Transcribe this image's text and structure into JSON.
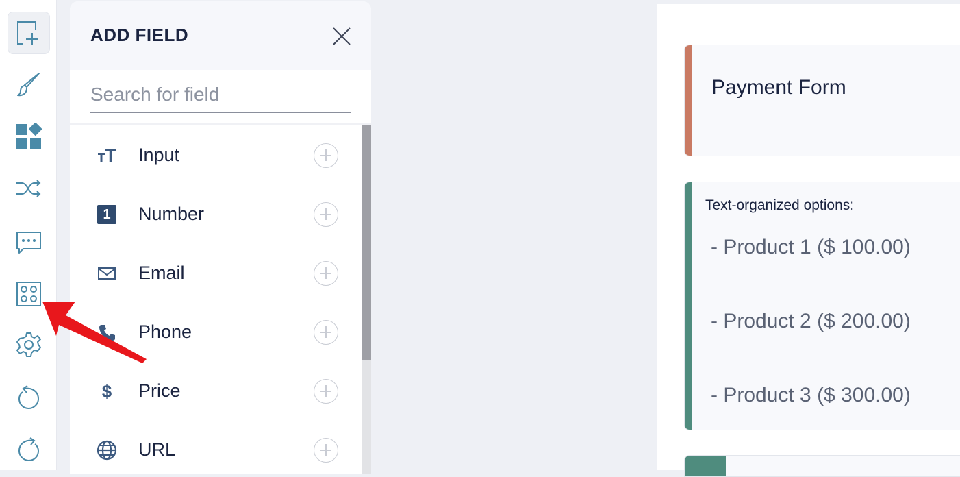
{
  "rail": {
    "items": [
      {
        "icon": "add-field-icon",
        "active": true
      },
      {
        "icon": "brush-icon"
      },
      {
        "icon": "widgets-icon"
      },
      {
        "icon": "shuffle-icon"
      },
      {
        "icon": "message-icon"
      },
      {
        "icon": "apps-grid-icon"
      },
      {
        "icon": "gear-icon"
      },
      {
        "icon": "undo-icon"
      },
      {
        "icon": "redo-icon"
      }
    ]
  },
  "panel": {
    "title": "ADD FIELD",
    "search_placeholder": "Search for field",
    "search_value": "",
    "items": [
      {
        "label": "Input",
        "icon": "text-input-icon"
      },
      {
        "label": "Number",
        "icon": "number-icon",
        "badge": "1"
      },
      {
        "label": "Email",
        "icon": "envelope-icon"
      },
      {
        "label": "Phone",
        "icon": "phone-icon"
      },
      {
        "label": "Price",
        "icon": "dollar-icon",
        "glyph": "$"
      },
      {
        "label": "URL",
        "icon": "globe-icon"
      }
    ]
  },
  "preview": {
    "title_card": {
      "title": "Payment Form",
      "accent": "#c97a63"
    },
    "options_card": {
      "label": "Text-organized options:",
      "accent": "#4f8c7e",
      "options": [
        "-  Product 1 ($ 100.00)",
        "-  Product 2 ($ 200.00)",
        "-  Product 3 ($ 300.00)"
      ]
    },
    "bottom_accent": "#4f8c7e"
  },
  "colors": {
    "icon_teal": "#4a8aa8",
    "arrow_red": "#e8171c",
    "text_dark": "#1b2440"
  }
}
